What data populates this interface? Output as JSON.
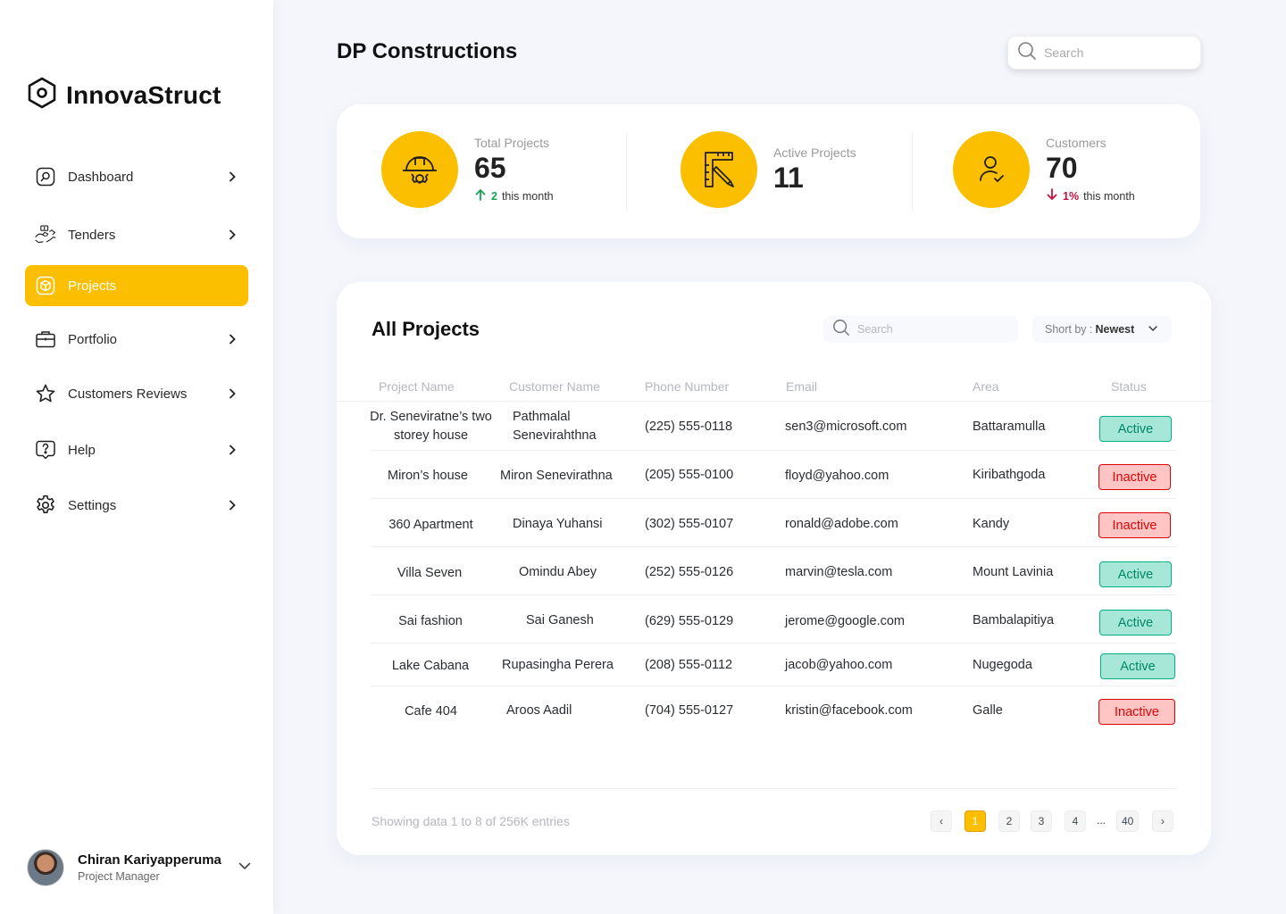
{
  "app": {
    "name": "InnovaStruct"
  },
  "sidebar": {
    "items": [
      {
        "label": "Dashboard",
        "icon": "dashboard-icon",
        "active": false
      },
      {
        "label": "Tenders",
        "icon": "tenders-icon",
        "active": false
      },
      {
        "label": "Projects",
        "icon": "cube-icon",
        "active": true
      },
      {
        "label": "Portfolio",
        "icon": "briefcase-icon",
        "active": false
      },
      {
        "label": "Customers Reviews",
        "icon": "star-icon",
        "active": false
      },
      {
        "label": "Help",
        "icon": "help-icon",
        "active": false
      },
      {
        "label": "Settings",
        "icon": "gear-icon",
        "active": false
      }
    ],
    "profile": {
      "name": "Chiran Kariyapperuma",
      "role": "Project Manager"
    }
  },
  "header": {
    "title": "DP Constructions",
    "search_placeholder": "Search"
  },
  "stats": [
    {
      "label": "Total Projects",
      "value": "65",
      "trend_value": "2",
      "trend_text": "this month",
      "trend_dir": "up",
      "icon": "helmet-gear-icon"
    },
    {
      "label": "Active Projects",
      "value": "11",
      "icon": "ruler-pencil-icon"
    },
    {
      "label": "Customers",
      "value": "70",
      "trend_value": "1%",
      "trend_text": "this month",
      "trend_dir": "down",
      "icon": "user-check-icon"
    }
  ],
  "projects": {
    "title": "All Projects",
    "search_placeholder": "Search",
    "sort_label": "Short by :",
    "sort_value": "Newest",
    "columns": [
      "Project Name",
      "Customer Name",
      "Phone Number",
      "Email",
      "Area",
      "Status"
    ],
    "rows": [
      {
        "project": "Dr. Seneviratne’s two storey house",
        "customer": "Pathmalal Senevirahthna",
        "phone": "(225) 555-0118",
        "email": "sen3@microsoft.com",
        "area": "Battaramulla",
        "status": "Active"
      },
      {
        "project": "Miron’s house",
        "customer": "Miron Senevirathna",
        "phone": "(205) 555-0100",
        "email": "floyd@yahoo.com",
        "area": "Kiribathgoda",
        "status": "Inactive"
      },
      {
        "project": "360 Apartment",
        "customer": "Dinaya Yuhansi",
        "phone": "(302) 555-0107",
        "email": "ronald@adobe.com",
        "area": "Kandy",
        "status": "Inactive"
      },
      {
        "project": "Villa Seven",
        "customer": "Omindu Abey",
        "phone": "(252) 555-0126",
        "email": "marvin@tesla.com",
        "area": "Mount Lavinia",
        "status": "Active"
      },
      {
        "project": "Sai fashion",
        "customer": "Sai Ganesh",
        "phone": "(629) 555-0129",
        "email": "jerome@google.com",
        "area": "Bambalapitiya",
        "status": "Active"
      },
      {
        "project": "Lake Cabana",
        "customer": "Rupasingha Perera",
        "phone": "(208) 555-0112",
        "email": "jacob@yahoo.com",
        "area": "Nugegoda",
        "status": "Active"
      },
      {
        "project": "Cafe 404",
        "customer": "Aroos Aadil",
        "phone": "(704) 555-0127",
        "email": "kristin@facebook.com",
        "area": "Galle",
        "status": "Inactive"
      }
    ],
    "footer_text": "Showing data 1 to 8 of  256K entries",
    "pagination": {
      "prev": "‹",
      "pages": [
        "1",
        "2",
        "3",
        "4"
      ],
      "ellipsis": "...",
      "last": "40",
      "next": "›",
      "current": "1"
    }
  },
  "colors": {
    "accent": "#fcbf00",
    "active_bg": "#a6e7d8",
    "active_text": "#008767",
    "inactive_bg": "#ffc5c5",
    "inactive_text": "#df0404"
  }
}
